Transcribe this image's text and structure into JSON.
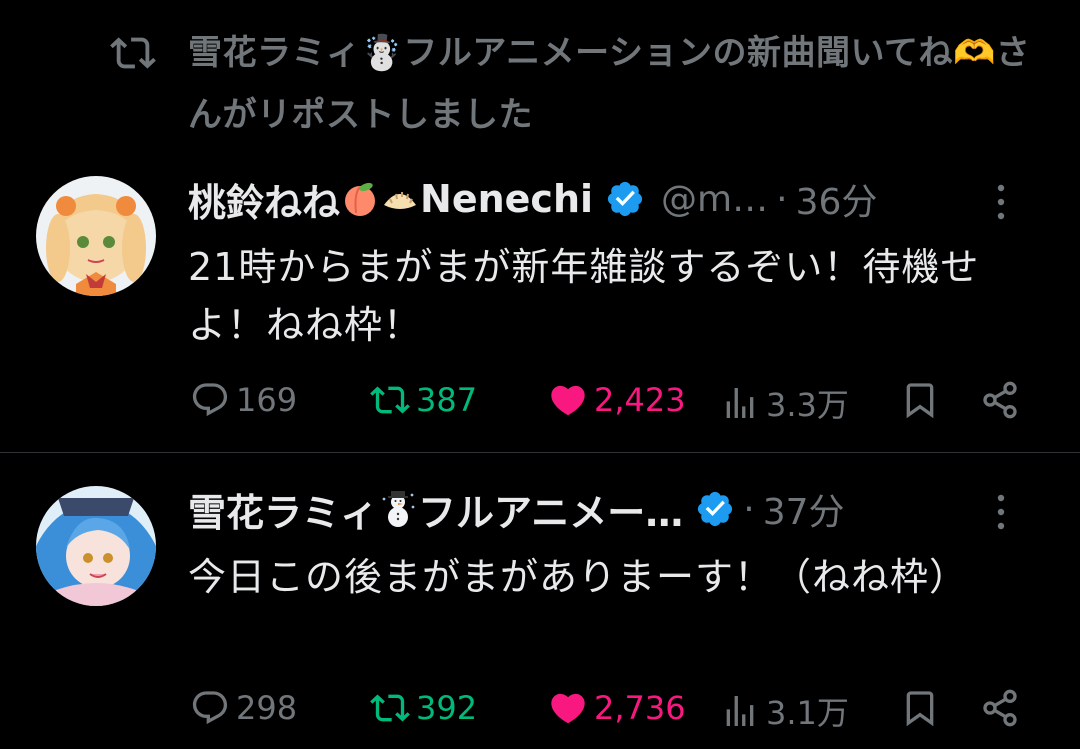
{
  "repost_header": {
    "text": "雪花ラミィ☃️フルアニメーションの新曲聞いてね🫶さんがリポストしました",
    "icon": "repost-icon"
  },
  "tweets": [
    {
      "display_name": "桃鈴ねね",
      "name_emoji_1": "peach-emoji",
      "name_emoji_2": "dumpling-emoji",
      "display_name_suffix": "Nenechi",
      "verified": true,
      "handle": "@m…",
      "dot": "·",
      "time": "36分",
      "text": "21時からまがまが新年雑談するぞい！待機せよ！ねね枠！",
      "replies": "169",
      "reposts": "387",
      "likes": "2,423",
      "views": "3.3万",
      "liked": true,
      "avatar_colors": [
        "#f6d8a8",
        "#f08a3c",
        "#c23b3b"
      ]
    },
    {
      "display_name": "雪花ラミィ",
      "name_emoji_1": "snowman-emoji",
      "display_name_suffix": "フルアニメー…",
      "verified": true,
      "handle": "",
      "dot": "·",
      "time": "37分",
      "text": "今日この後まがまがありまーす！（ねね枠）",
      "replies": "298",
      "reposts": "392",
      "likes": "2,736",
      "views": "3.1万",
      "liked": true,
      "avatar_colors": [
        "#bfe3f5",
        "#3a8fd8",
        "#f2c7d6"
      ]
    }
  ],
  "colors": {
    "background": "#000000",
    "text_primary": "#e7e9ea",
    "text_secondary": "#71767b",
    "repost_green": "#00ba7c",
    "like_pink": "#f91880",
    "verified_blue": "#1d9bf0",
    "divider": "#2f3336"
  }
}
